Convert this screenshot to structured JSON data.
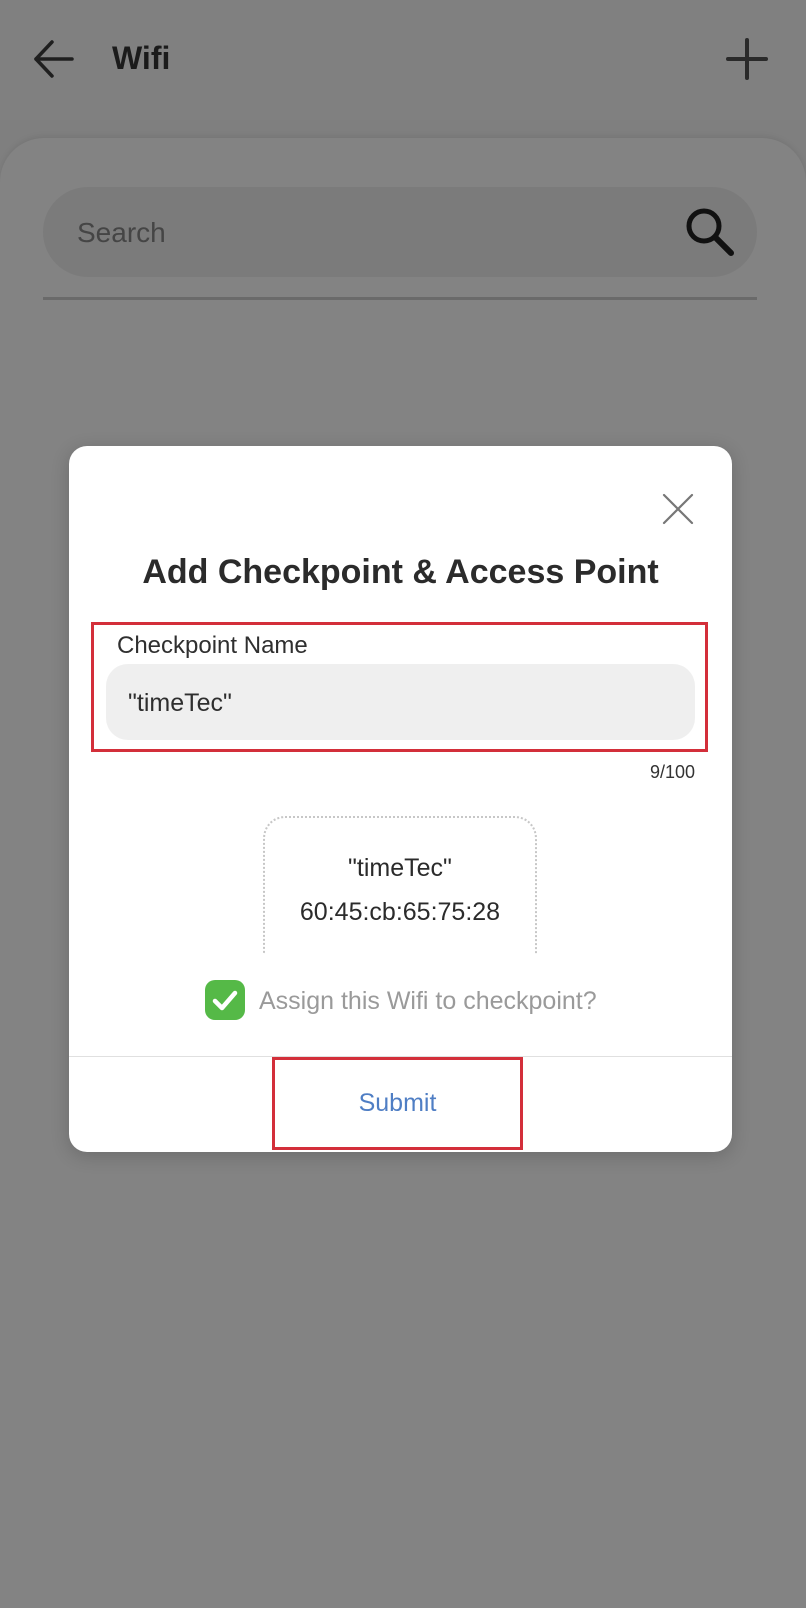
{
  "header": {
    "title": "Wifi",
    "back_icon": "arrow-left-icon",
    "add_icon": "plus-icon"
  },
  "search": {
    "placeholder": "Search",
    "value": "",
    "icon": "search-icon"
  },
  "dialog": {
    "title": "Add Checkpoint & Access Point",
    "close_icon": "close-icon",
    "field": {
      "label": "Checkpoint Name",
      "value": "\"timeTec\"",
      "counter": "9/100"
    },
    "wifi": {
      "name": "\"timeTec\"",
      "mac": "60:45:cb:65:75:28"
    },
    "assign": {
      "label": "Assign this Wifi to checkpoint?",
      "checked": true
    },
    "submit_label": "Submit"
  },
  "colors": {
    "overlay_background": "#7f7f7f",
    "dialog_background": "#ffffff",
    "highlight": "#d32f3a",
    "submit_text": "#4f7ec4",
    "checkbox": "#55b947"
  }
}
